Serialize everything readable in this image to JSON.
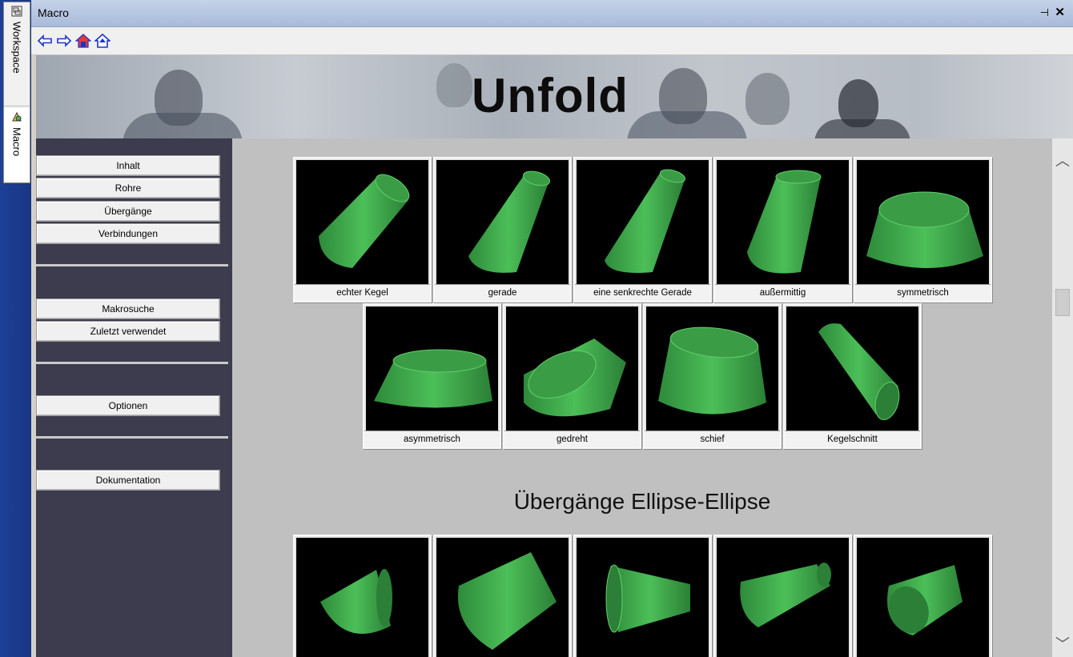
{
  "side_tabs": {
    "workspace": "Workspace",
    "macro": "Macro"
  },
  "window": {
    "title": "Macro",
    "pin": "⊣",
    "close": "✕"
  },
  "toolbar": {
    "back": "back-arrow-icon",
    "forward": "forward-arrow-icon",
    "home": "home-icon",
    "home2": "home-up-icon"
  },
  "banner": {
    "title": "Unfold"
  },
  "nav": {
    "items": [
      "Inhalt",
      "Rohre",
      "Übergänge",
      "Verbindungen",
      "Makrosuche",
      "Zuletzt verwendet",
      "Optionen",
      "Dokumentation"
    ]
  },
  "gallery_row1": [
    {
      "label": "echter Kegel"
    },
    {
      "label": "gerade"
    },
    {
      "label": "eine senkrechte Gerade"
    },
    {
      "label": "außermittig"
    },
    {
      "label": "symmetrisch"
    }
  ],
  "gallery_row2": [
    {
      "label": "asymmetrisch"
    },
    {
      "label": "gedreht"
    },
    {
      "label": "schief"
    },
    {
      "label": "Kegelschnitt"
    }
  ],
  "section": {
    "heading": "Übergänge Ellipse-Ellipse"
  },
  "gallery_row3": [
    {
      "label": ""
    },
    {
      "label": ""
    },
    {
      "label": ""
    },
    {
      "label": ""
    },
    {
      "label": ""
    }
  ],
  "colors": {
    "cone_green": "#3ea64a",
    "cone_dark": "#2b7f36",
    "nav_bg": "#3c3c4e",
    "content_bg": "#c0c0c0"
  }
}
